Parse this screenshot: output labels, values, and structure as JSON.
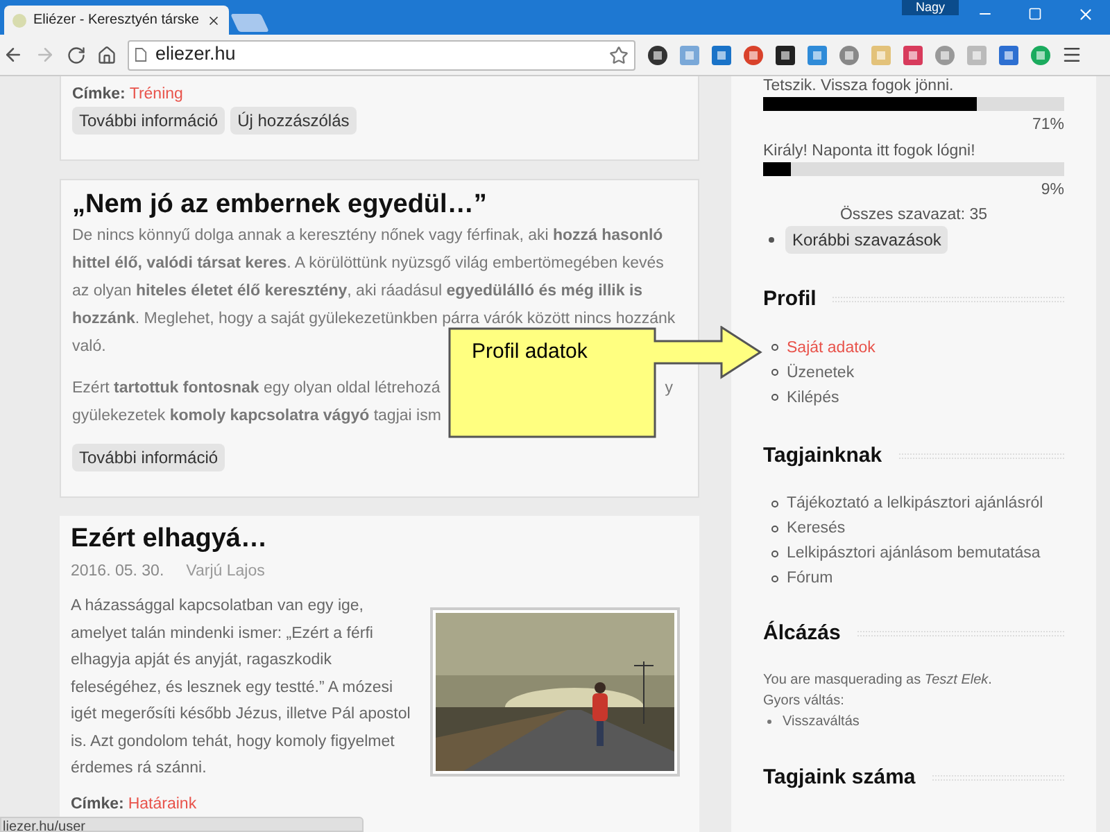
{
  "browser": {
    "tabs": [
      {
        "title": "Eliézer - Keresztyén társke",
        "selected": true
      }
    ],
    "user": "Nagy",
    "address": "eliezer.hu"
  },
  "posts": [
    {
      "kind": "tail",
      "tag_label": "Címke:",
      "tag": "Tréning",
      "buttons": [
        "További információ",
        "Új hozzászólás"
      ]
    },
    {
      "kind": "intro",
      "title": "„Nem jó az embernek egyedül…”",
      "paragraphs": [
        [
          "De nincs könnyű dolga annak a keresztény nőnek vagy férfinak, aki **hozzá hasonló**",
          "**hittel élő, valódi társat keres**. A körülöttünk nyüzsgő világ embertömegében kevés",
          "az olyan **hiteles életet élő keresztény**, aki ráadásul **egyedülálló és még illik is**",
          "**hozzánk**. Meglehet, hogy a saját gyülekezetünkben párra várók között nincs hozzánk",
          "való."
        ],
        [
          "Ezért **tartottuk fontosnak** egy olyan oldal létrehozá",
          "gyülekezetek **komoly kapcsolatra vágyó** tagjai ism"
        ]
      ],
      "right_fragment": "y",
      "buttons": [
        "További információ"
      ]
    },
    {
      "kind": "article",
      "title": "Ezért elhagyá…",
      "date": "2016. 05. 30.",
      "author": "Varjú Lajos",
      "text": "A házassággal kapcsolatban van egy ige, amelyet talán mindenki ismer: „Ezért a férfi elhagyja apját és anyját, ragaszkodik feleségéhez, és lesznek egy testté.” A mózesi igét megerősíti később Jézus, illetve Pál apostol is. Azt gondolom tehát, hogy komoly figyelmet érdemes rá szánni.",
      "tag_label": "Címke:",
      "tag": "Határaink"
    }
  ],
  "sidebar": {
    "poll": {
      "options": [
        {
          "label": "Tetszik. Vissza fogok jönni.",
          "level": 0.71,
          "reading": "71%"
        },
        {
          "label": "Király! Naponta itt fogok lógni!",
          "level": 0.09,
          "reading": "9%"
        }
      ],
      "total": "Összes szavazat: 35",
      "archive_button": "Korábbi szavazások"
    },
    "profile": {
      "title": "Profil",
      "items": [
        {
          "label": "Saját adatok",
          "selected": true
        },
        {
          "label": "Üzenetek",
          "selected": false
        },
        {
          "label": "Kilépés",
          "selected": false
        }
      ]
    },
    "members": {
      "title": "Tagjainknak",
      "items": [
        {
          "label": "Tájékoztató a lelkipásztori ajánlásról"
        },
        {
          "label": "Keresés"
        },
        {
          "label": "Lelkipásztori ajánlásom bemutatása"
        },
        {
          "label": "Fórum"
        }
      ]
    },
    "masquerade": {
      "title": "Álcázás",
      "note": "You are masquerading as *Teszt Elek*.",
      "switch_label": "Gyors váltás:",
      "items": [
        "Visszaváltás"
      ]
    },
    "count": {
      "title": "Tagjaink száma"
    }
  },
  "callout": {
    "text": "Profil adatok"
  },
  "status_bar": {
    "url": "liezer.hu/user"
  }
}
